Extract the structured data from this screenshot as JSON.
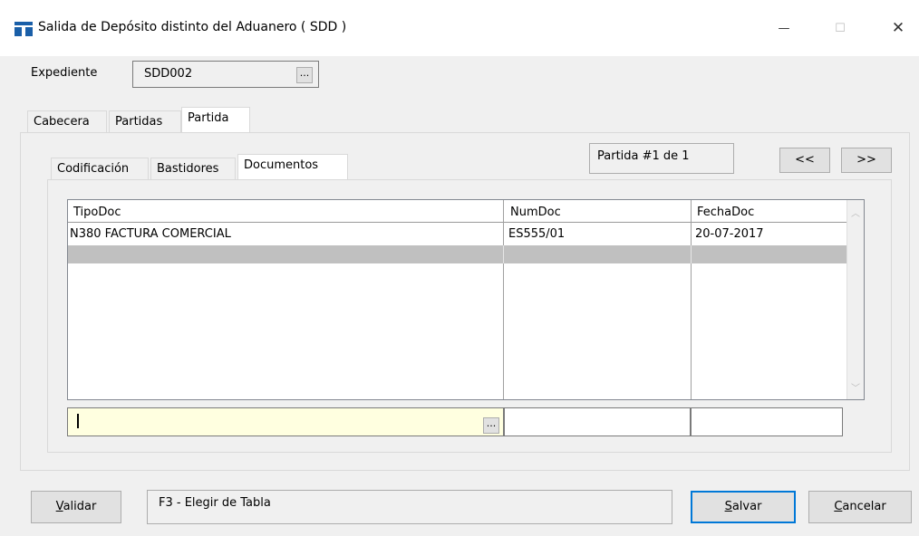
{
  "window": {
    "title": "Salida de Depósito distinto del Aduanero ( SDD )",
    "icon": "app-icon",
    "min_glyph": "—",
    "max_glyph": "☐",
    "close_glyph": "✕"
  },
  "expediente": {
    "label": "Expediente",
    "value": "SDD002",
    "browse_label": "..."
  },
  "main_tabs": [
    {
      "label": "Cabecera"
    },
    {
      "label": "Partidas"
    },
    {
      "label": "Partida",
      "active": true
    }
  ],
  "sub_tabs": [
    {
      "label": "Codificación"
    },
    {
      "label": "Bastidores"
    },
    {
      "label": "Documentos",
      "active": true
    }
  ],
  "partida_nav": {
    "text": "Partida #1 de 1",
    "prev_label": "<<",
    "next_label": ">>"
  },
  "grid": {
    "columns": [
      "TipoDoc",
      "NumDoc",
      "FechaDoc"
    ],
    "rows": [
      [
        "N380 FACTURA COMERCIAL",
        "ES555/01",
        "20-07-2017"
      ]
    ],
    "selected_row_color": "#c0c0c0"
  },
  "editor": {
    "tipodoc_value": "",
    "browse_label": "...",
    "highlight_color": "#ffffe0"
  },
  "status": {
    "text": "F3 - Elegir de Tabla"
  },
  "buttons": {
    "validar": {
      "accel": "V",
      "rest": "alidar"
    },
    "salvar": {
      "accel": "S",
      "rest": "alvar"
    },
    "cancelar": {
      "accel": "C",
      "rest": "ancelar"
    }
  }
}
